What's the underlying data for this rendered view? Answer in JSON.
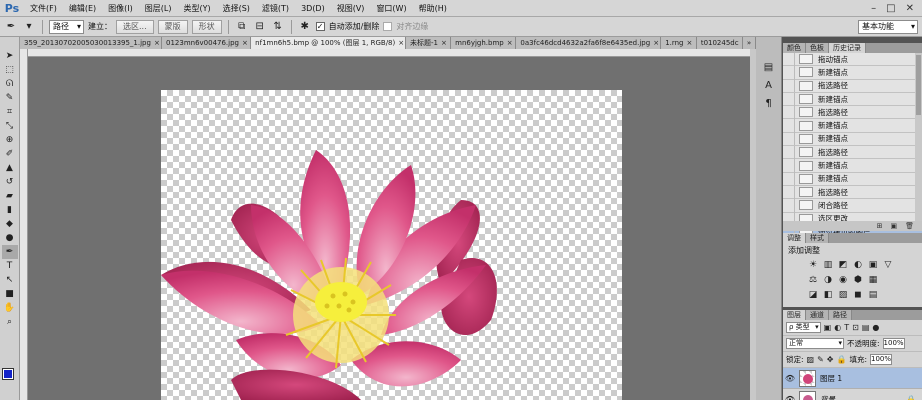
{
  "menubar": {
    "logo": "Ps",
    "items": [
      "文件(F)",
      "编辑(E)",
      "图像(I)",
      "图层(L)",
      "类型(Y)",
      "选择(S)",
      "滤镜(T)",
      "3D(D)",
      "视图(V)",
      "窗口(W)",
      "帮助(H)"
    ],
    "window_controls": [
      "–",
      "□",
      "✕"
    ]
  },
  "options": {
    "tool_icon": "pen-icon",
    "mode": "路径",
    "build_label": "建立：",
    "selection_btn": "选区...",
    "mask_btn": "蒙版",
    "shape_btn": "形状",
    "auto_add_label": "自动添加/删除",
    "auto_add_checked": true,
    "align_edges_label": "对齐边缘",
    "align_edges_checked": false,
    "workspace": "基本功能"
  },
  "tabs": [
    {
      "label": "359_20130702005030013395_1.jpg",
      "active": false
    },
    {
      "label": "0123mn6v00476.jpg",
      "active": false
    },
    {
      "label": "nf1mn6h5.bmp @ 100% (图层 1, RGB/8)",
      "active": true
    },
    {
      "label": "未标题-1",
      "active": false
    },
    {
      "label": "mn6yjgh.bmp",
      "active": false
    },
    {
      "label": "0a3fc46dcd4632a2fa6f8e6435ed.jpg",
      "active": false
    },
    {
      "label": "1.rng",
      "active": false
    },
    {
      "label": "t010245dc",
      "active": false
    }
  ],
  "tabs_overflow": "»",
  "history_panel": {
    "tabs": [
      {
        "label": "颜色",
        "active": false
      },
      {
        "label": "色板",
        "active": false
      },
      {
        "label": "历史记录",
        "active": true
      }
    ],
    "items": [
      {
        "label": "拖动锚点",
        "selected": false
      },
      {
        "label": "新建锚点",
        "selected": false
      },
      {
        "label": "拖选路径",
        "selected": false
      },
      {
        "label": "新建锚点",
        "selected": false
      },
      {
        "label": "拖选路径",
        "selected": false
      },
      {
        "label": "新建锚点",
        "selected": false
      },
      {
        "label": "新建锚点",
        "selected": false
      },
      {
        "label": "拖选路径",
        "selected": false
      },
      {
        "label": "新建锚点",
        "selected": false
      },
      {
        "label": "新建锚点",
        "selected": false
      },
      {
        "label": "拖选路径",
        "selected": false
      },
      {
        "label": "闭合路径",
        "selected": false
      },
      {
        "label": "选区更改",
        "selected": false
      },
      {
        "label": "通过拷贝的图层",
        "selected": true
      }
    ],
    "footer_icons": [
      "⊞",
      "▣",
      "🗑"
    ]
  },
  "adjust_panel": {
    "tabs": [
      {
        "label": "调整",
        "active": true
      },
      {
        "label": "样式",
        "active": false
      }
    ],
    "title": "添加调整",
    "icons": [
      "☀",
      "▥",
      "◩",
      "◐",
      "▣",
      "▽",
      "⚖",
      "◑",
      "◉",
      "⬢",
      "▦",
      "",
      "◪",
      "◧",
      "▨",
      "◼",
      "▤",
      ""
    ]
  },
  "layers_panel": {
    "tabs": [
      {
        "label": "图层",
        "active": true
      },
      {
        "label": "通道",
        "active": false
      },
      {
        "label": "路径",
        "active": false
      }
    ],
    "filter_label": "ρ 类型",
    "blend_mode": "正常",
    "opacity_label": "不透明度:",
    "opacity": "100%",
    "lock_label": "锁定:",
    "fill_label": "填充:",
    "fill": "100%",
    "layers": [
      {
        "name": "图层 1",
        "selected": true,
        "visible": true,
        "italic": false,
        "locked": false
      },
      {
        "name": "背景",
        "selected": false,
        "visible": true,
        "italic": true,
        "locked": true
      }
    ]
  },
  "colors": {
    "foreground": "#1222c8",
    "background": "#ffffff",
    "selection": "#a8bfe0"
  }
}
